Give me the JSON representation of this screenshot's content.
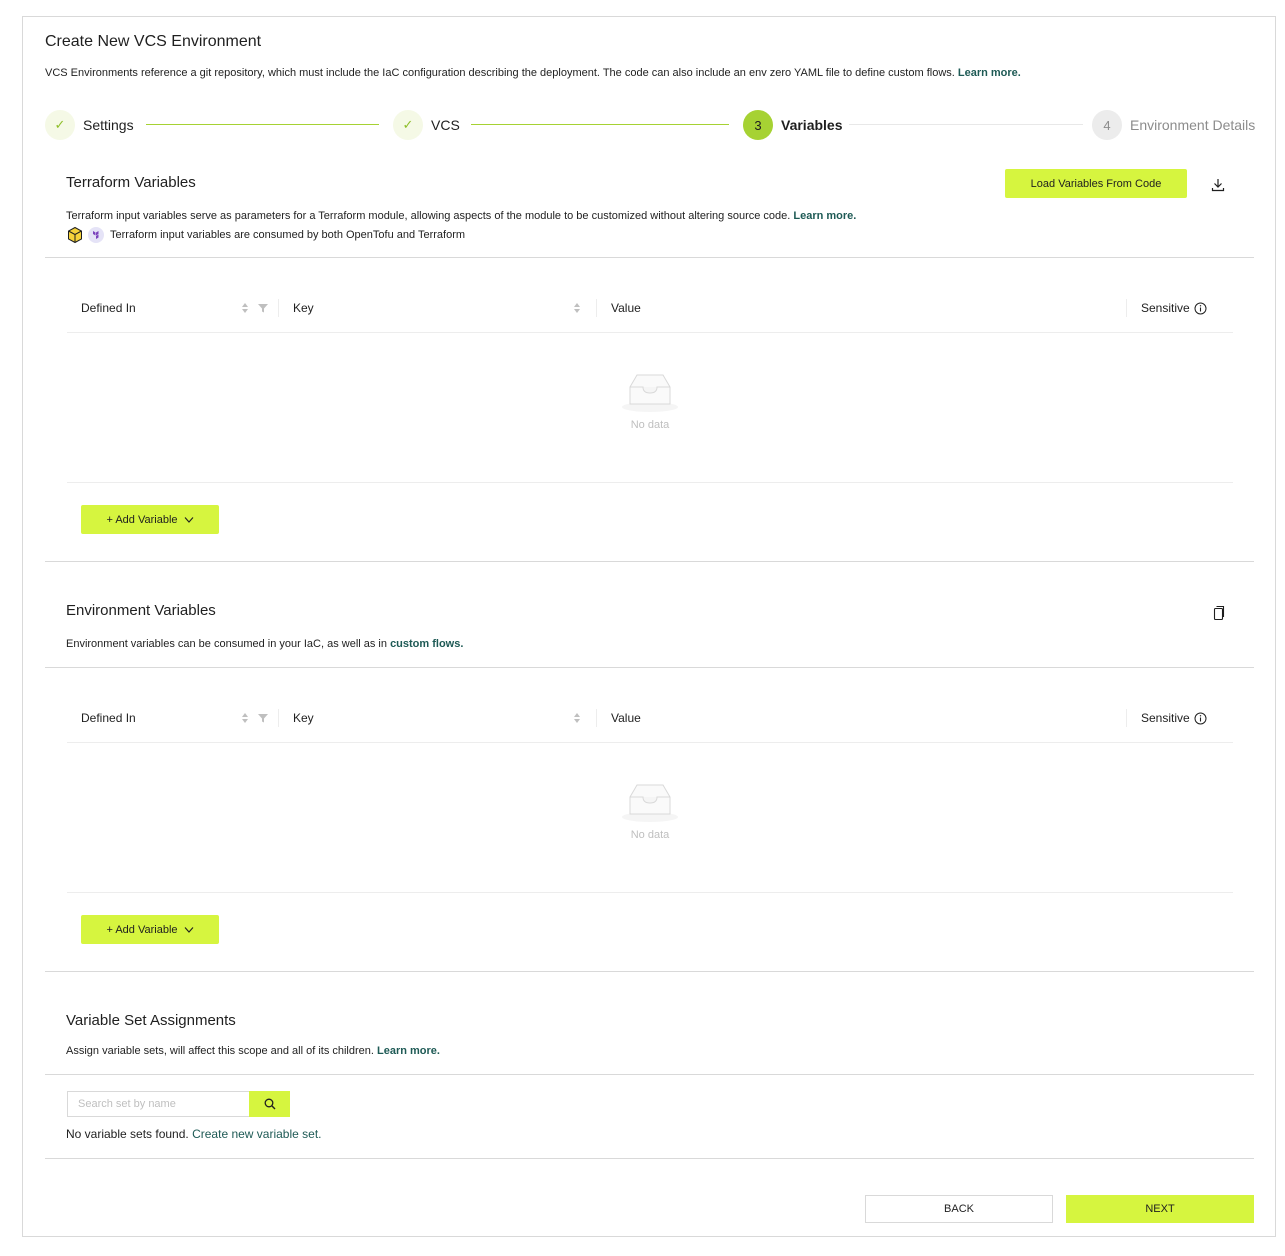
{
  "header": {
    "title": "Create New VCS Environment",
    "description": "VCS Environments reference a git repository, which must include the IaC configuration describing the deployment. The code can also include an env zero YAML file to define custom flows.",
    "learn_more": "Learn more."
  },
  "steps": [
    {
      "label": "Settings",
      "state": "done",
      "marker": "✓"
    },
    {
      "label": "VCS",
      "state": "done",
      "marker": "✓"
    },
    {
      "label": "Variables",
      "state": "active",
      "marker": "3"
    },
    {
      "label": "Environment Details",
      "state": "todo",
      "marker": "4"
    }
  ],
  "terraform": {
    "title": "Terraform Variables",
    "load_button": "Load Variables From Code",
    "description": "Terraform input variables serve as parameters for a Terraform module, allowing aspects of the module to be customized without altering source code.",
    "learn_more": "Learn more.",
    "consumed_note": "Terraform input variables are consumed by both OpenTofu and Terraform",
    "table": {
      "columns": [
        "Defined In",
        "Key",
        "Value",
        "Sensitive"
      ],
      "empty_text": "No data"
    },
    "add_button": "+ Add Variable"
  },
  "environment": {
    "title": "Environment Variables",
    "description": "Environment variables can be consumed in your IaC, as well as in",
    "custom_flows_link": "custom flows.",
    "table": {
      "columns": [
        "Defined In",
        "Key",
        "Value",
        "Sensitive"
      ],
      "empty_text": "No data"
    },
    "add_button": "+ Add Variable"
  },
  "variable_sets": {
    "title": "Variable Set Assignments",
    "description": "Assign variable sets, will affect this scope and all of its children.",
    "learn_more": "Learn more.",
    "search_placeholder": "Search set by name",
    "empty_text": "No variable sets found.",
    "create_link": "Create new variable set."
  },
  "footer": {
    "back": "BACK",
    "next": "NEXT"
  },
  "colors": {
    "accent": "#d6f53f",
    "step_active": "#a6d233",
    "link": "#1e5a55"
  }
}
